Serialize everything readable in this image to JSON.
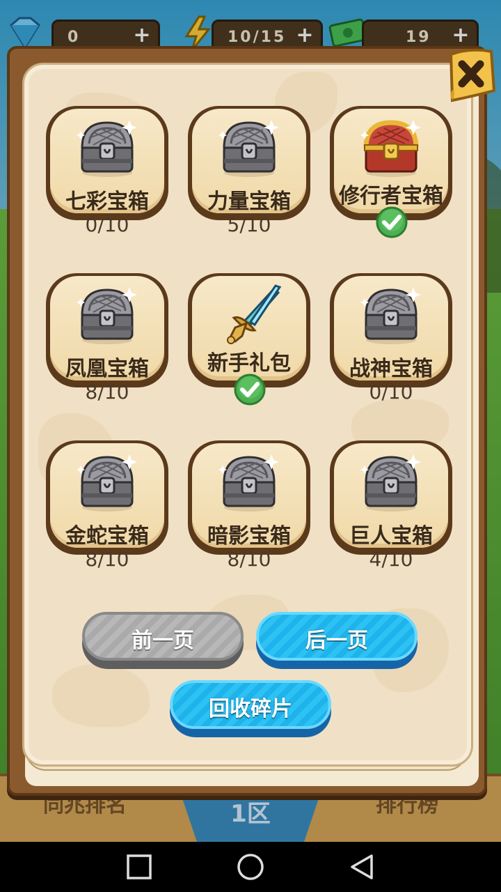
{
  "resources": {
    "gems": "0",
    "energy": "10/15",
    "cash": "19"
  },
  "bottom": {
    "left_tab": "同兆排名",
    "zone": "1区",
    "right_tab": "排行榜"
  },
  "chests": [
    {
      "name": "七彩宝箱",
      "progress": "0/10",
      "icon": "silver-chest-icon"
    },
    {
      "name": "力量宝箱",
      "progress": "5/10",
      "icon": "silver-chest-icon"
    },
    {
      "name": "修行者宝箱",
      "progress": "",
      "icon": "gold-chest-icon",
      "claimed": true
    },
    {
      "name": "凤凰宝箱",
      "progress": "8/10",
      "icon": "silver-chest-icon"
    },
    {
      "name": "新手礼包",
      "progress": "",
      "icon": "sword-icon",
      "claimed": true
    },
    {
      "name": "战神宝箱",
      "progress": "0/10",
      "icon": "silver-chest-icon"
    },
    {
      "name": "金蛇宝箱",
      "progress": "8/10",
      "icon": "silver-chest-icon"
    },
    {
      "name": "暗影宝箱",
      "progress": "8/10",
      "icon": "silver-chest-icon"
    },
    {
      "name": "巨人宝箱",
      "progress": "4/10",
      "icon": "silver-chest-icon"
    }
  ],
  "buttons": {
    "prev": "前一页",
    "next": "后一页",
    "recycle": "回收碎片"
  },
  "colors": {
    "parchment": "#f0e1c6",
    "frame": "#8a5a2e",
    "button_blue": "#2ec2f4",
    "button_gray": "#b8b8b8",
    "check_green": "#4caf50"
  }
}
